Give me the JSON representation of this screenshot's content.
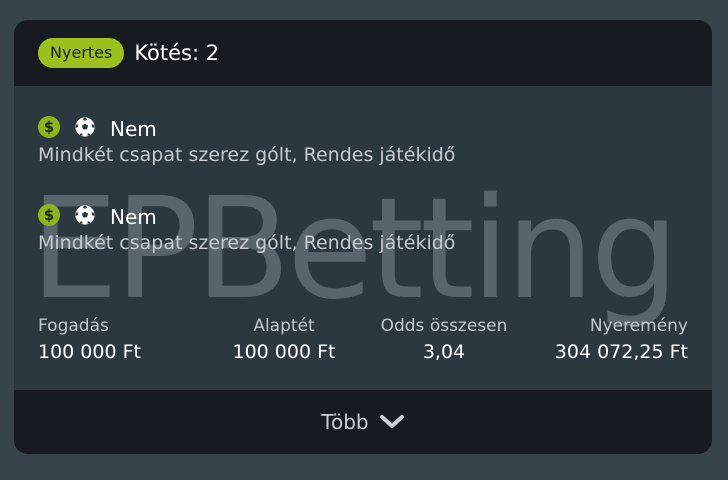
{
  "header": {
    "status_badge": "Nyertes",
    "title": "Kötés: 2"
  },
  "watermark": "EPBetting",
  "selections": [
    {
      "name": "Nem",
      "market": "Mindkét csapat szerez gólt, Rendes játékidő",
      "icons": [
        "dollar-icon",
        "soccer-ball-icon"
      ]
    },
    {
      "name": "Nem",
      "market": "Mindkét csapat szerez gólt, Rendes játékidő",
      "icons": [
        "dollar-icon",
        "soccer-ball-icon"
      ]
    }
  ],
  "stats": {
    "stake": {
      "label": "Fogadás",
      "value": "100 000 Ft"
    },
    "base_stake": {
      "label": "Alaptét",
      "value": "100 000 Ft"
    },
    "total_odds": {
      "label": "Odds összesen",
      "value": "3,04"
    },
    "winnings": {
      "label": "Nyeremény",
      "value": "304 072,25 Ft"
    }
  },
  "footer": {
    "more_label": "Több"
  },
  "colors": {
    "accent": "#9dc11c",
    "header_bg": "#151b20",
    "card_bg": "#2b3840",
    "page_bg": "#37444c"
  }
}
